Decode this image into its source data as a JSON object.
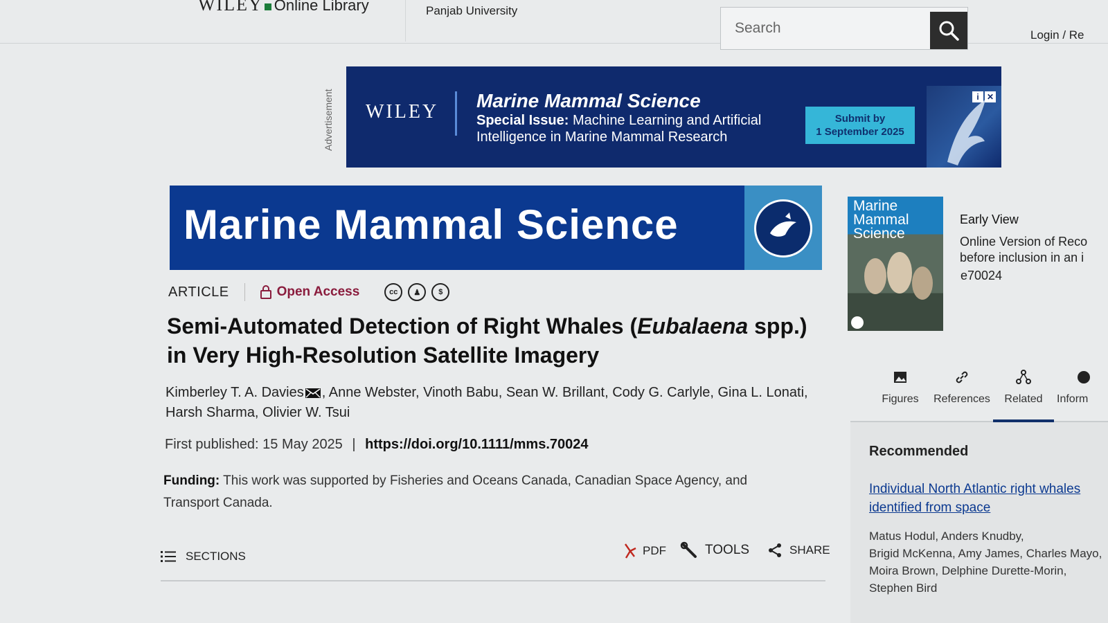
{
  "header": {
    "brand_wiley": "WILEY",
    "brand_suffix": "Online Library",
    "institution": "Panjab University",
    "search_placeholder": "Search",
    "login_label": "Login / Re"
  },
  "ad": {
    "side_label": "Advertisement",
    "wiley": "WILEY",
    "journal": "Marine Mammal Science",
    "special_label": "Special Issue:",
    "special_text": " Machine Learning and Artificial Intelligence in Marine Mammal Research",
    "cta_line1": "Submit by",
    "cta_line2": "1 September 2025"
  },
  "journal_banner": {
    "title": "Marine Mammal Science"
  },
  "article": {
    "type": "ARTICLE",
    "access": "Open Access",
    "license_icons": [
      "cc-icon",
      "by-icon",
      "nc-icon"
    ],
    "title_part1": "Semi-Automated Detection of Right Whales (",
    "title_italic": "Eubalaena",
    "title_part2": " spp.) in Very High-Resolution Satellite Imagery",
    "author_first": "Kimberley T. A. Davies",
    "authors_rest": ", Anne Webster, Vinoth Babu, Sean W. Brillant, Cody G. Carlyle, Gina L. Lonati, Harsh Sharma, Olivier W. Tsui",
    "first_published_label": "First published: 15 May 2025",
    "pub_sep": "|",
    "doi": "https://doi.org/10.1111/mms.70024",
    "funding_label": "Funding:",
    "funding_text": " This work was supported by Fisheries and Oceans Canada, Canadian Space Agency, and Transport Canada."
  },
  "actions": {
    "sections": "SECTIONS",
    "pdf": "PDF",
    "tools": "TOOLS",
    "share": "SHARE"
  },
  "sidebar": {
    "cover_title": "Marine Mammal Science",
    "early_view_heading": "Early View",
    "early_view_text_1": "Online Version of Reco",
    "early_view_text_2": "before inclusion in an i",
    "article_id": "e70024",
    "tabs": [
      {
        "label": "Figures",
        "icon": "image-icon"
      },
      {
        "label": "References",
        "icon": "link-icon"
      },
      {
        "label": "Related",
        "icon": "related-icon"
      },
      {
        "label": "Inform",
        "icon": "info-icon"
      }
    ],
    "active_tab": "Related",
    "recommended_heading": "Recommended",
    "rec_link_1": "Individual North Atlantic right whales",
    "rec_link_2": "identified from space",
    "rec_authors_1": "Matus Hodul, Anders Knudby,",
    "rec_authors_2": "Brigid McKenna, Amy James, Charles Mayo,",
    "rec_authors_3": "Moira Brown, Delphine Durette-Morin,",
    "rec_authors_4": "Stephen Bird"
  },
  "colors": {
    "brand_blue": "#0b3990",
    "ad_blue": "#0f2a6d",
    "ad_cta": "#35b6d8",
    "open_access": "#8a1c3d"
  }
}
